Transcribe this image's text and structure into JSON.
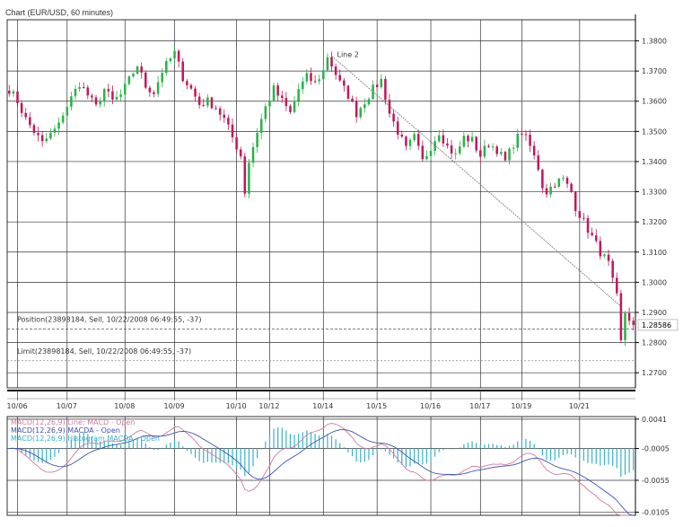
{
  "window": {
    "title": "Chart (EUR/USD, 60 minutes)"
  },
  "colors": {
    "background": "#ffffff",
    "grid": "#333333",
    "bull_candle": "#2bb24a",
    "bear_candle": "#c2185b",
    "macd_line": "#d07aa0",
    "macd_signal": "#3f51b5",
    "histogram": "#35b3c9",
    "trendline": "#777777",
    "position_line": "#555555",
    "limit_line": "#888888"
  },
  "chart_data": [
    {
      "type": "candlestick",
      "title": "Chart (EUR/USD, 60 minutes)",
      "ylim": [
        1.265,
        1.387
      ],
      "yticks": [
        1.38,
        1.37,
        1.36,
        1.35,
        1.34,
        1.33,
        1.32,
        1.31,
        1.3,
        1.29,
        1.28,
        1.27
      ],
      "ytick_labels": [
        "1.3800",
        "1.3700",
        "1.3600",
        "1.3500",
        "1.3400",
        "1.3300",
        "1.3200",
        "1.3100",
        "1.3000",
        "1.2900",
        "1.2800",
        "1.2700"
      ],
      "x_count": 152,
      "xtick_labels": [
        {
          "label": "10/06",
          "i": 2
        },
        {
          "label": "10/07",
          "i": 14
        },
        {
          "label": "10/08",
          "i": 28
        },
        {
          "label": "10/09",
          "i": 40
        },
        {
          "label": "10/10",
          "i": 55
        },
        {
          "label": "10/12",
          "i": 63
        },
        {
          "label": "10/14",
          "i": 76
        },
        {
          "label": "10/15",
          "i": 89
        },
        {
          "label": "10/16",
          "i": 102
        },
        {
          "label": "10/17",
          "i": 114
        },
        {
          "label": "10/19",
          "i": 124
        },
        {
          "label": "10/21",
          "i": 138
        }
      ],
      "close_anchors": [
        [
          0,
          1.364
        ],
        [
          2,
          1.36
        ],
        [
          4,
          1.354
        ],
        [
          6,
          1.35
        ],
        [
          8,
          1.346
        ],
        [
          10,
          1.349
        ],
        [
          12,
          1.352
        ],
        [
          13,
          1.356
        ],
        [
          15,
          1.361
        ],
        [
          17,
          1.366
        ],
        [
          19,
          1.362
        ],
        [
          21,
          1.358
        ],
        [
          23,
          1.364
        ],
        [
          25,
          1.36
        ],
        [
          27,
          1.362
        ],
        [
          29,
          1.367
        ],
        [
          31,
          1.372
        ],
        [
          33,
          1.365
        ],
        [
          35,
          1.363
        ],
        [
          37,
          1.37
        ],
        [
          39,
          1.374
        ],
        [
          40,
          1.376
        ],
        [
          42,
          1.368
        ],
        [
          44,
          1.364
        ],
        [
          46,
          1.359
        ],
        [
          48,
          1.36
        ],
        [
          50,
          1.358
        ],
        [
          52,
          1.354
        ],
        [
          54,
          1.348
        ],
        [
          56,
          1.342
        ],
        [
          57,
          1.33
        ],
        [
          58,
          1.34
        ],
        [
          60,
          1.35
        ],
        [
          62,
          1.358
        ],
        [
          64,
          1.364
        ],
        [
          66,
          1.36
        ],
        [
          68,
          1.356
        ],
        [
          70,
          1.364
        ],
        [
          72,
          1.368
        ],
        [
          74,
          1.366
        ],
        [
          76,
          1.37
        ],
        [
          77,
          1.375
        ],
        [
          78,
          1.372
        ],
        [
          80,
          1.366
        ],
        [
          82,
          1.362
        ],
        [
          84,
          1.356
        ],
        [
          86,
          1.36
        ],
        [
          88,
          1.364
        ],
        [
          90,
          1.367
        ],
        [
          92,
          1.356
        ],
        [
          94,
          1.35
        ],
        [
          96,
          1.344
        ],
        [
          98,
          1.348
        ],
        [
          100,
          1.34
        ],
        [
          102,
          1.345
        ],
        [
          104,
          1.35
        ],
        [
          106,
          1.345
        ],
        [
          108,
          1.342
        ],
        [
          110,
          1.348
        ],
        [
          112,
          1.347
        ],
        [
          114,
          1.342
        ],
        [
          116,
          1.346
        ],
        [
          118,
          1.344
        ],
        [
          120,
          1.34
        ],
        [
          122,
          1.346
        ],
        [
          124,
          1.35
        ],
        [
          126,
          1.345
        ],
        [
          128,
          1.338
        ],
        [
          129,
          1.332
        ],
        [
          130,
          1.33
        ],
        [
          132,
          1.333
        ],
        [
          134,
          1.334
        ],
        [
          136,
          1.33
        ],
        [
          137,
          1.325
        ],
        [
          139,
          1.32
        ],
        [
          141,
          1.315
        ],
        [
          143,
          1.31
        ],
        [
          145,
          1.306
        ],
        [
          146,
          1.3
        ],
        [
          147,
          1.295
        ],
        [
          148,
          1.28
        ],
        [
          149,
          1.29
        ],
        [
          150,
          1.288
        ],
        [
          151,
          1.286
        ]
      ],
      "current_price_label": "1.28586",
      "current_price": 1.28586,
      "annotations": [
        {
          "label": "Line 2",
          "price": 1.374,
          "i": 78
        },
        {
          "label": "Position(23898184, Sell, 10/22/2008 06:49:55, -37)",
          "price": 1.2845
        },
        {
          "label": "Limit(23898184, Sell, 10/22/2008 06:49:55, -37)",
          "price": 1.274
        }
      ],
      "trendline": {
        "i_start": 78,
        "price_start": 1.375,
        "i_end": 148,
        "price_end": 1.292
      },
      "position_price": 1.2845,
      "limit_price": 1.274,
      "grid": true
    },
    {
      "type": "line",
      "ylim": [
        -0.011,
        0.0045
      ],
      "yticks": [
        0.0041,
        -0.0005,
        -0.0055,
        -0.0105
      ],
      "ytick_labels": [
        "0.0041",
        "-0.0005",
        "-0.0055",
        "-0.0105"
      ],
      "legend": [
        "MACD(12,26,9) Line; MACD - Open",
        "MACD(12,26,9) MACDA - Open",
        "MACD(12,26,9) Histogram MACDA - Open"
      ],
      "legend_placement": "top-left",
      "grid": true
    }
  ]
}
